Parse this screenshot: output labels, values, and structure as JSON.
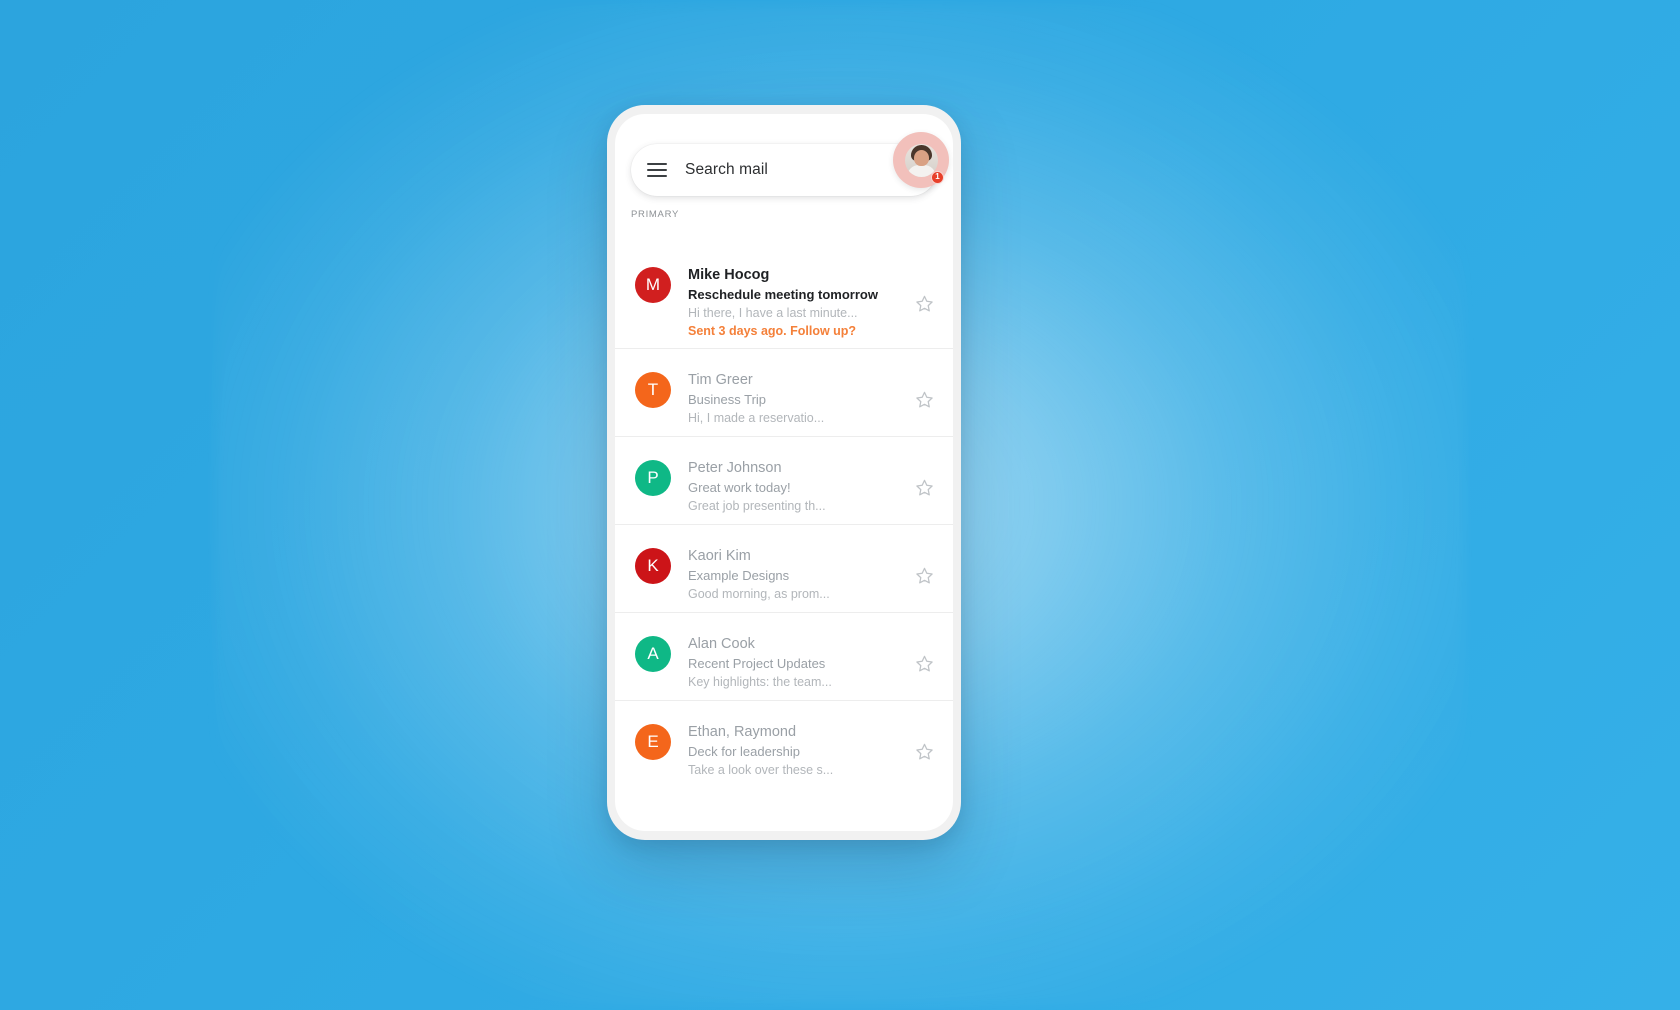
{
  "background": {
    "color": "#2ba8e0",
    "glow": "#ffffff"
  },
  "app": {
    "search": {
      "placeholder_text": "Search mail",
      "menu_icon": "hamburger-menu-icon"
    },
    "avatar": {
      "badge_count": "1",
      "badge_color": "#e8402a",
      "ring_color": "#f2c0bb"
    },
    "category_label": "PRIMARY",
    "emails": [
      {
        "sender": "Mike Hocog",
        "subject": "Reschedule meeting tomorrow",
        "snippet": "Hi there, I have a last minute...",
        "nudge": "Sent 3 days ago. Follow up?",
        "initial": "M",
        "avatar_color": "#d11f1f",
        "unread": true,
        "starred": false
      },
      {
        "sender": "Tim Greer",
        "subject": "Business Trip",
        "snippet": "Hi, I made a reservatio...",
        "nudge": "",
        "initial": "T",
        "avatar_color": "#f4661b",
        "unread": false,
        "starred": false
      },
      {
        "sender": "Peter Johnson",
        "subject": "Great work today!",
        "snippet": "Great job presenting th...",
        "nudge": "",
        "initial": "P",
        "avatar_color": "#0fb886",
        "unread": false,
        "starred": false
      },
      {
        "sender": "Kaori Kim",
        "subject": "Example Designs",
        "snippet": "Good morning, as prom...",
        "nudge": "",
        "initial": "K",
        "avatar_color": "#cc1418",
        "unread": false,
        "starred": false
      },
      {
        "sender": "Alan Cook",
        "subject": "Recent Project Updates",
        "snippet": "Key highlights: the team...",
        "nudge": "",
        "initial": "A",
        "avatar_color": "#0fb886",
        "unread": false,
        "starred": false
      },
      {
        "sender": "Ethan, Raymond",
        "subject": "Deck for leadership",
        "snippet": "Take a look over these s...",
        "nudge": "",
        "initial": "E",
        "avatar_color": "#f4661b",
        "unread": false,
        "starred": false
      }
    ]
  }
}
